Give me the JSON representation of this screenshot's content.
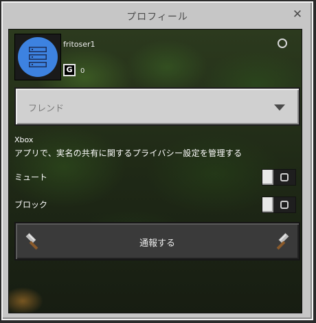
{
  "dialog": {
    "title": "プロフィール",
    "close_icon": "close-icon"
  },
  "profile": {
    "gamertag": "fritoser1",
    "gamerscore": "0",
    "avatar_icon": "server-stack-icon",
    "status_icon": "online-status-icon",
    "score_icon": "gamerscore-icon",
    "score_glyph": "G"
  },
  "relationship": {
    "selected": "フレンド",
    "arrow_icon": "chevron-down-icon"
  },
  "privacy": {
    "heading": "Xbox",
    "description": "アプリで、実名の共有に関するプライバシー設定を管理する"
  },
  "toggles": [
    {
      "label": "ミュート",
      "on": false
    },
    {
      "label": "ブロック",
      "on": false
    }
  ],
  "report": {
    "label": "通報する",
    "icon": "hammer-icon"
  },
  "colors": {
    "avatar_bg": "#3d82e0",
    "dialog_bg": "#c6c6c6",
    "button_dark": "#3a3a3a"
  }
}
